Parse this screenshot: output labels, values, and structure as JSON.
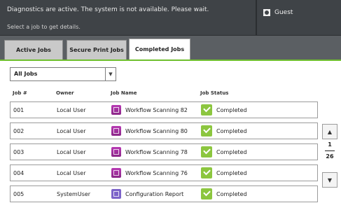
{
  "topbar": {
    "status_message": "Diagnostics are active. The system is not available. Please wait.",
    "hint": "Select a job to get details.",
    "user": "Guest"
  },
  "tabs": [
    {
      "label": "Active Jobs",
      "active": false
    },
    {
      "label": "Secure Print Jobs",
      "active": false
    },
    {
      "label": "Completed Jobs",
      "active": true
    }
  ],
  "filter": {
    "selected": "All Jobs"
  },
  "table": {
    "headers": [
      "Job #",
      "Owner",
      "Job Name",
      "Job Status"
    ],
    "rows": [
      {
        "job": "001",
        "owner": "Local User",
        "name": "Workflow Scanning 82",
        "status": "Completed",
        "icon": "scan-document-icon"
      },
      {
        "job": "002",
        "owner": "Local User",
        "name": "Workflow Scanning 80",
        "status": "Completed",
        "icon": "scan-document-icon"
      },
      {
        "job": "003",
        "owner": "Local User",
        "name": "Workflow Scanning 78",
        "status": "Completed",
        "icon": "scan-document-icon"
      },
      {
        "job": "004",
        "owner": "Local User",
        "name": "Workflow Scanning 76",
        "status": "Completed",
        "icon": "scan-document-icon"
      },
      {
        "job": "005",
        "owner": "SystemUser",
        "name": "Configuration Report",
        "status": "Completed",
        "icon": "print-report-icon"
      }
    ]
  },
  "pager": {
    "current": "1",
    "total": "26"
  },
  "colors": {
    "accent": "#6fbf2e",
    "status_ok": "#8cc63f",
    "scan_icon": "#a8329f",
    "report_icon": "#7c63c9",
    "topbar": "#3f4347"
  }
}
